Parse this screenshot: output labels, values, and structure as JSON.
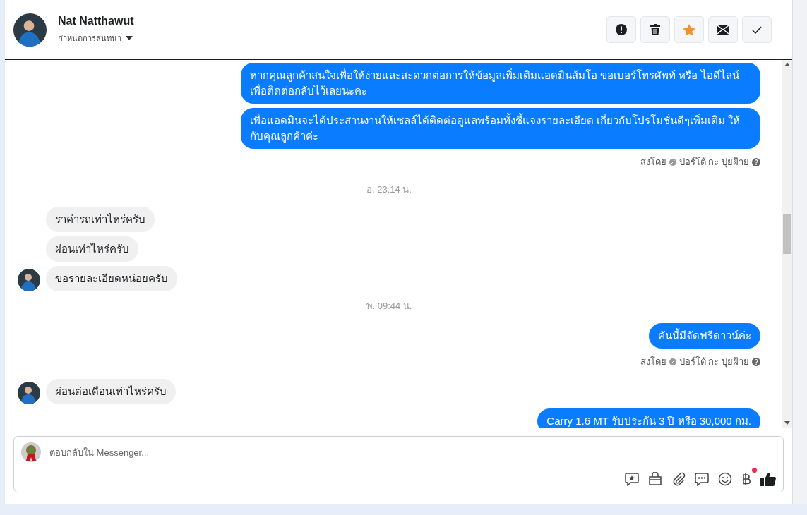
{
  "header": {
    "name": "Nat Natthawut",
    "subtitle": "กำหนดการสนทนา",
    "actions": [
      {
        "kind": "alert",
        "highlighted": false
      },
      {
        "kind": "trash",
        "highlighted": false
      },
      {
        "kind": "star",
        "highlighted": true
      },
      {
        "kind": "mail",
        "highlighted": false
      },
      {
        "kind": "done",
        "highlighted": false
      }
    ]
  },
  "messages": [
    {
      "kind": "outgoing",
      "text": "หากคุณลูกค้าสนใจเพื่อให้ง่ายและสะดวกต่อการให้ข้อมูลเพิ่มเติมแอดมินส้มโอ ขอเบอร์โทรศัพท์ หรือ ไอดีไลน์ เพื่อติดต่อกลับไว้เลยนะคะ"
    },
    {
      "kind": "outgoing",
      "text": "เพื่อแอดมินจะได้ประสานงานให้เซลล์ได้ติดต่อดูแลพร้อมทั้งชี้แจงรายละเอียด เกี่ยวกับโปรโมชั่นดีๆเพิ่มเติม ให้กับคุณลูกค้าค่ะ"
    },
    {
      "kind": "sent_by",
      "label": "ส่งโดย",
      "sender": "ปอร์โต้ กะ ปุยฝ้าย"
    },
    {
      "kind": "timestamp",
      "text": "อ. 23:14 น."
    },
    {
      "kind": "incoming",
      "text": "ราค่ารถเท่าไหร่ครับ",
      "avatar": false
    },
    {
      "kind": "incoming",
      "text": "ผ่อนเท่าไหร่ครับ",
      "avatar": false
    },
    {
      "kind": "incoming",
      "text": "ขอรายละเอียดหน่อยครับ",
      "avatar": true
    },
    {
      "kind": "timestamp",
      "text": "พ. 09:44 น."
    },
    {
      "kind": "outgoing",
      "text": "คันนี้มีจัดฟรีดาวน์ค่ะ"
    },
    {
      "kind": "sent_by",
      "label": "ส่งโดย",
      "sender": "ปอร์โต้ กะ ปุยฝ้าย"
    },
    {
      "kind": "incoming",
      "text": "ผ่อนต่อเดือนเท่าไหร่ครับ",
      "avatar": true
    },
    {
      "kind": "outgoing",
      "text": "Carry 1.6 MT รับประกัน 3 ปี หรือ 30,000 กม."
    }
  ],
  "composer": {
    "placeholder": "ตอบกลับใน Messenger...",
    "tools": [
      {
        "kind": "saved-reply",
        "badge": false
      },
      {
        "kind": "shop",
        "badge": false
      },
      {
        "kind": "attach",
        "badge": false
      },
      {
        "kind": "chat",
        "badge": false
      },
      {
        "kind": "emoji",
        "badge": false
      },
      {
        "kind": "baht",
        "badge": true
      },
      {
        "kind": "like",
        "badge": false
      }
    ]
  }
}
